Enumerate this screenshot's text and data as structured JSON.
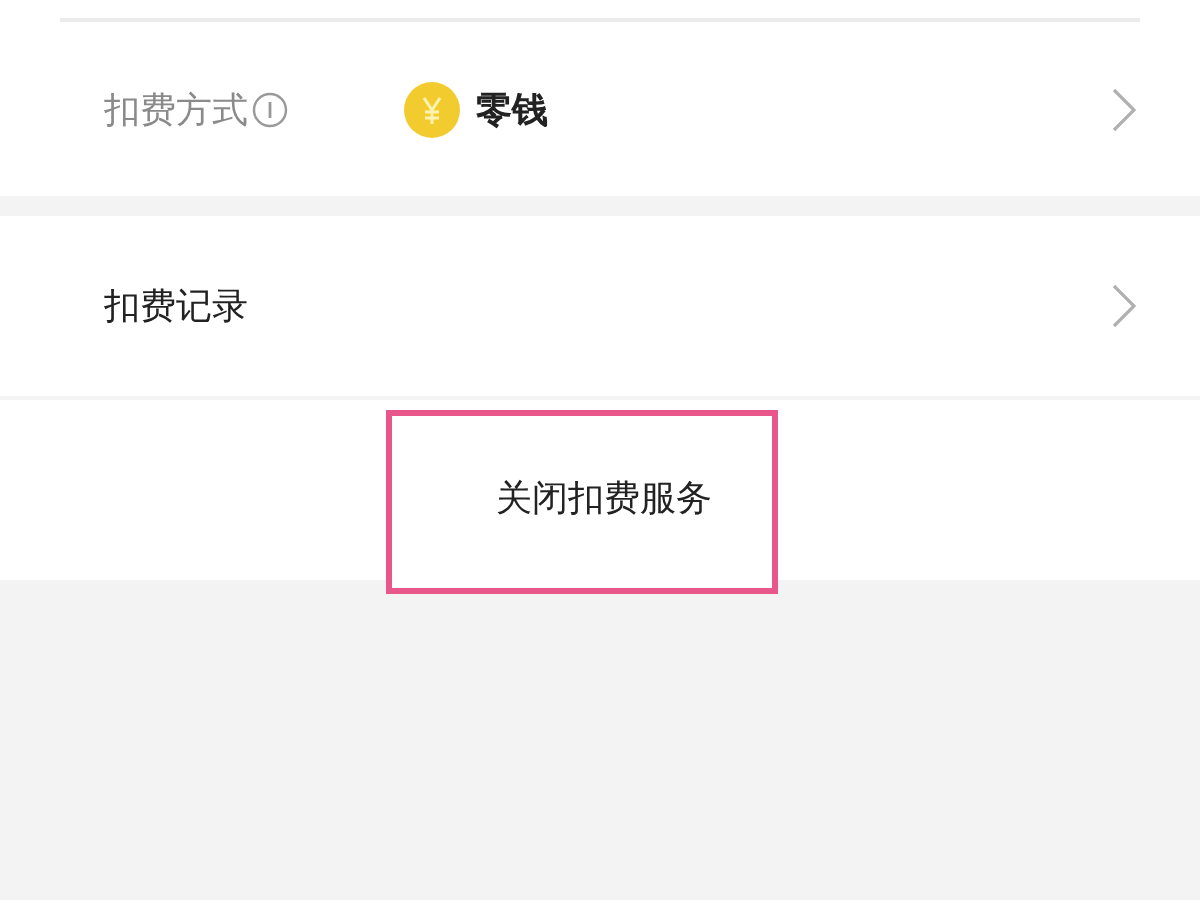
{
  "payment_method": {
    "label": "扣费方式",
    "value": "零钱"
  },
  "records": {
    "label": "扣费记录"
  },
  "close_button": {
    "label": "关闭扣费服务"
  }
}
